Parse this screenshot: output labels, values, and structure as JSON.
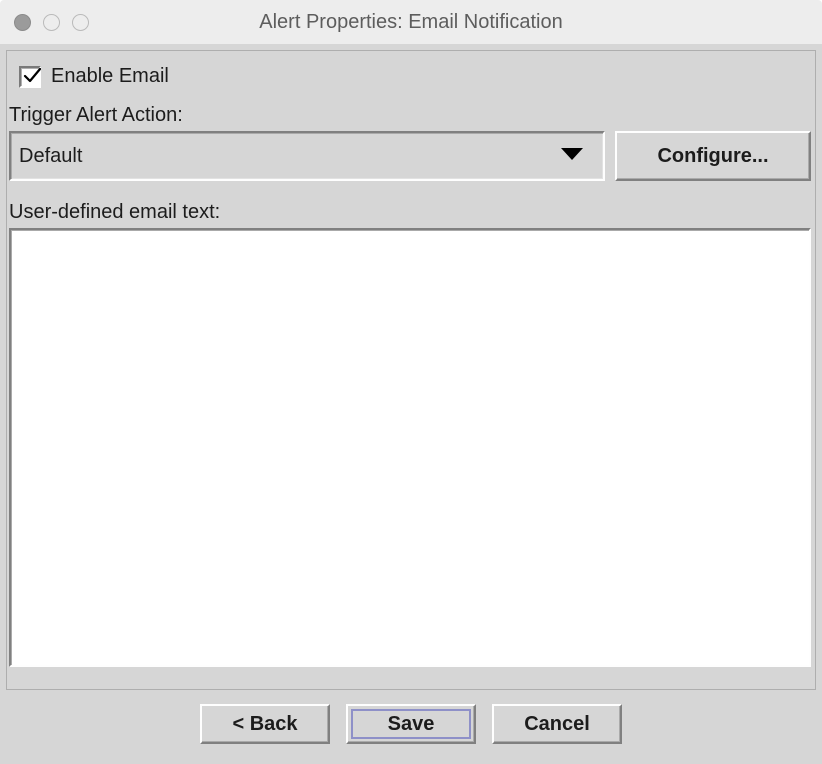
{
  "title": "Alert Properties: Email Notification",
  "enable_email": {
    "label": "Enable Email",
    "checked": true
  },
  "trigger": {
    "label": "Trigger Alert Action:",
    "selected": "Default",
    "configure_label": "Configure..."
  },
  "user_text": {
    "label": "User-defined email text:",
    "value": ""
  },
  "buttons": {
    "back": "< Back",
    "save": "Save",
    "cancel": "Cancel"
  }
}
